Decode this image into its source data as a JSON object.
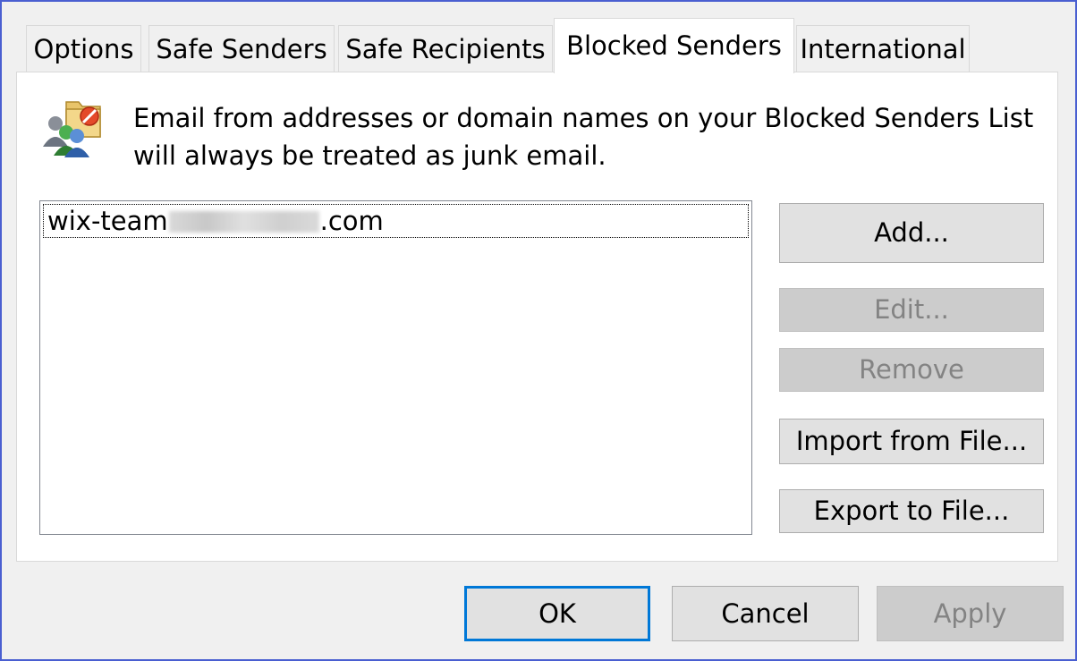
{
  "tabs": [
    {
      "label": "Options"
    },
    {
      "label": "Safe Senders"
    },
    {
      "label": "Safe Recipients"
    },
    {
      "label": "Blocked Senders"
    },
    {
      "label": "International"
    }
  ],
  "active_tab": "Blocked Senders",
  "description": {
    "line1": "Email from addresses or domain names on your Blocked Senders List",
    "line2": "will always be treated as junk email."
  },
  "list": {
    "items": [
      {
        "prefix": "wix-team",
        "suffix": ".com"
      }
    ]
  },
  "side_buttons": {
    "add": "Add...",
    "edit": "Edit...",
    "remove": "Remove",
    "import": "Import from File...",
    "export": "Export to File..."
  },
  "footer": {
    "ok": "OK",
    "cancel": "Cancel",
    "apply": "Apply"
  },
  "colors": {
    "accent": "#0078d7",
    "frame": "#4a5fd1",
    "disabled_text": "#838383"
  }
}
